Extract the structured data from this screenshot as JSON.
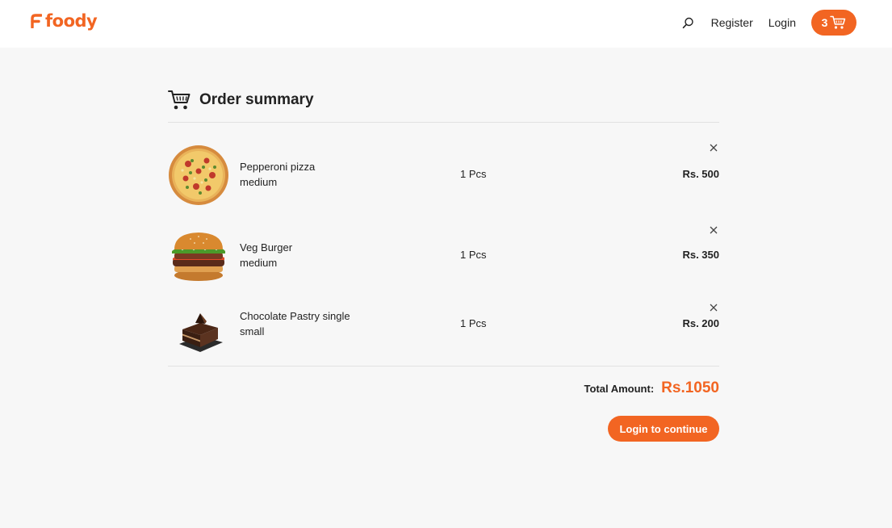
{
  "brand": {
    "name": "foody",
    "color": "#f26522"
  },
  "nav": {
    "search_icon": "search-icon",
    "register_label": "Register",
    "login_label": "Login",
    "cart_count": "3",
    "cart_icon": "shopping-cart-icon"
  },
  "summary": {
    "title": "Order summary",
    "items": [
      {
        "name": "Pepperoni pizza",
        "size": "medium",
        "quantity": "1 Pcs",
        "price": "Rs. 500",
        "image": "pepperoni-pizza"
      },
      {
        "name": "Veg Burger",
        "size": "medium",
        "quantity": "1 Pcs",
        "price": "Rs. 350",
        "image": "veg-burger"
      },
      {
        "name": "Chocolate Pastry single",
        "size": "small",
        "quantity": "1 Pcs",
        "price": "Rs. 200",
        "image": "chocolate-pastry"
      }
    ],
    "total_label": "Total Amount:",
    "total_value": "Rs.1050",
    "cta_label": "Login to continue"
  }
}
